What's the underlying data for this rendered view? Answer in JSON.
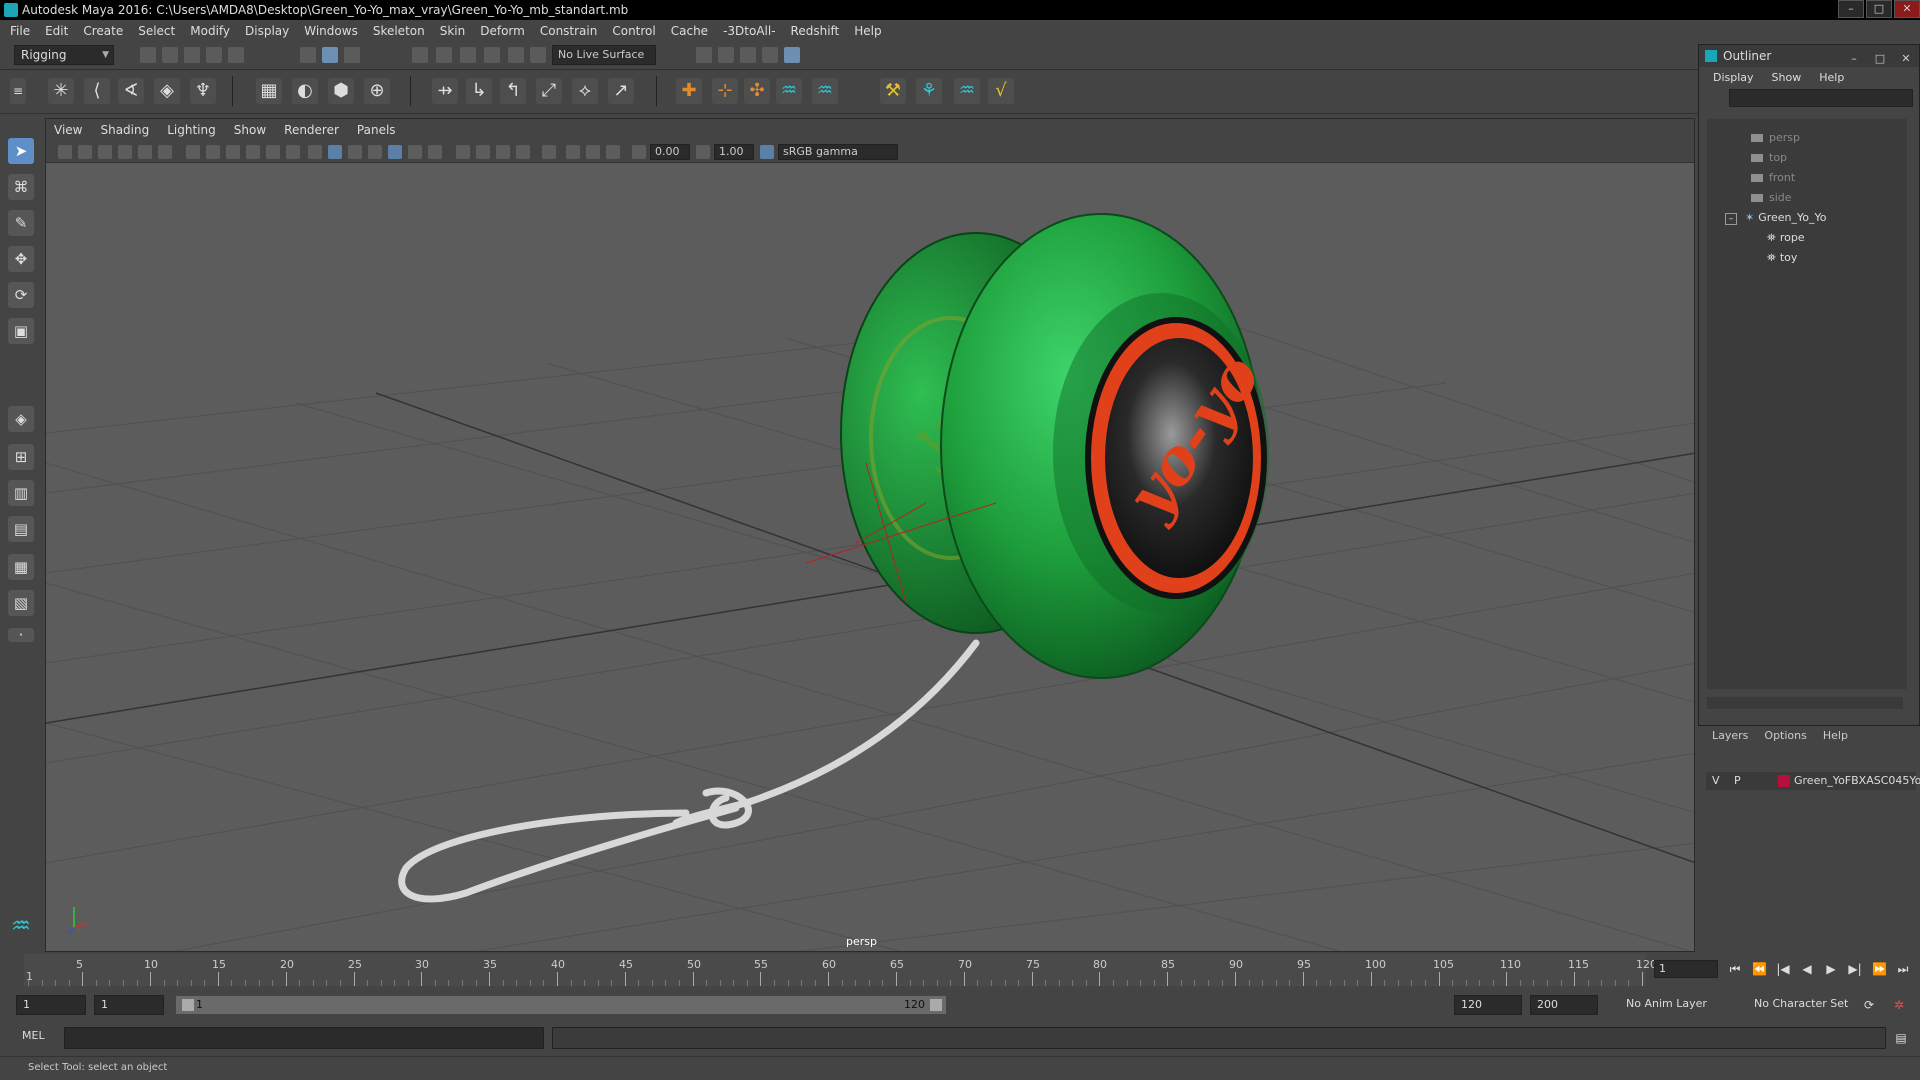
{
  "window": {
    "title": "Autodesk Maya 2016: C:\\Users\\AMDA8\\Desktop\\Green_Yo-Yo_max_vray\\Green_Yo-Yo_mb_standart.mb"
  },
  "menubar": [
    "File",
    "Edit",
    "Create",
    "Select",
    "Modify",
    "Display",
    "Windows",
    "Skeleton",
    "Skin",
    "Deform",
    "Constrain",
    "Control",
    "Cache",
    "-3DtoAll-",
    "Redshift",
    "Help"
  ],
  "toolbar": {
    "menuset": "Rigging",
    "live_surface": "No Live Surface"
  },
  "viewport": {
    "menu": [
      "View",
      "Shading",
      "Lighting",
      "Show",
      "Renderer",
      "Panels"
    ],
    "exposure": "0.00",
    "gamma": "1.00",
    "color_space": "sRGB gamma",
    "camera_label": "persp",
    "yoyo_text": "yo-yo"
  },
  "outliner": {
    "title": "Outliner",
    "menu": [
      "Display",
      "Show",
      "Help"
    ],
    "items": [
      {
        "label": "persp"
      },
      {
        "label": "top"
      },
      {
        "label": "front"
      },
      {
        "label": "side"
      },
      {
        "label": "Green_Yo_Yo"
      },
      {
        "label": "rope"
      },
      {
        "label": "toy"
      }
    ]
  },
  "layers": {
    "menu": [
      "Layers",
      "Options",
      "Help"
    ],
    "row": {
      "v": "V",
      "p": "P",
      "name": "Green_YoFBXASC045Yo",
      "color": "#b4103b"
    }
  },
  "timeline": {
    "ticks": [
      "5",
      "10",
      "15",
      "20",
      "25",
      "30",
      "35",
      "40",
      "45",
      "50",
      "55",
      "60",
      "65",
      "70",
      "75",
      "80",
      "85",
      "90",
      "95",
      "100",
      "105",
      "110",
      "115",
      "120"
    ],
    "start_label": "1",
    "current_frame": "1"
  },
  "range": {
    "start": "1",
    "anim_start": "1",
    "bar_start": "1",
    "bar_end": "120",
    "anim_end": "120",
    "end": "200",
    "anim_layer": "No Anim Layer",
    "character_set": "No Character Set"
  },
  "command": {
    "label": "MEL"
  },
  "helpline": {
    "text": "Select Tool: select an object"
  }
}
